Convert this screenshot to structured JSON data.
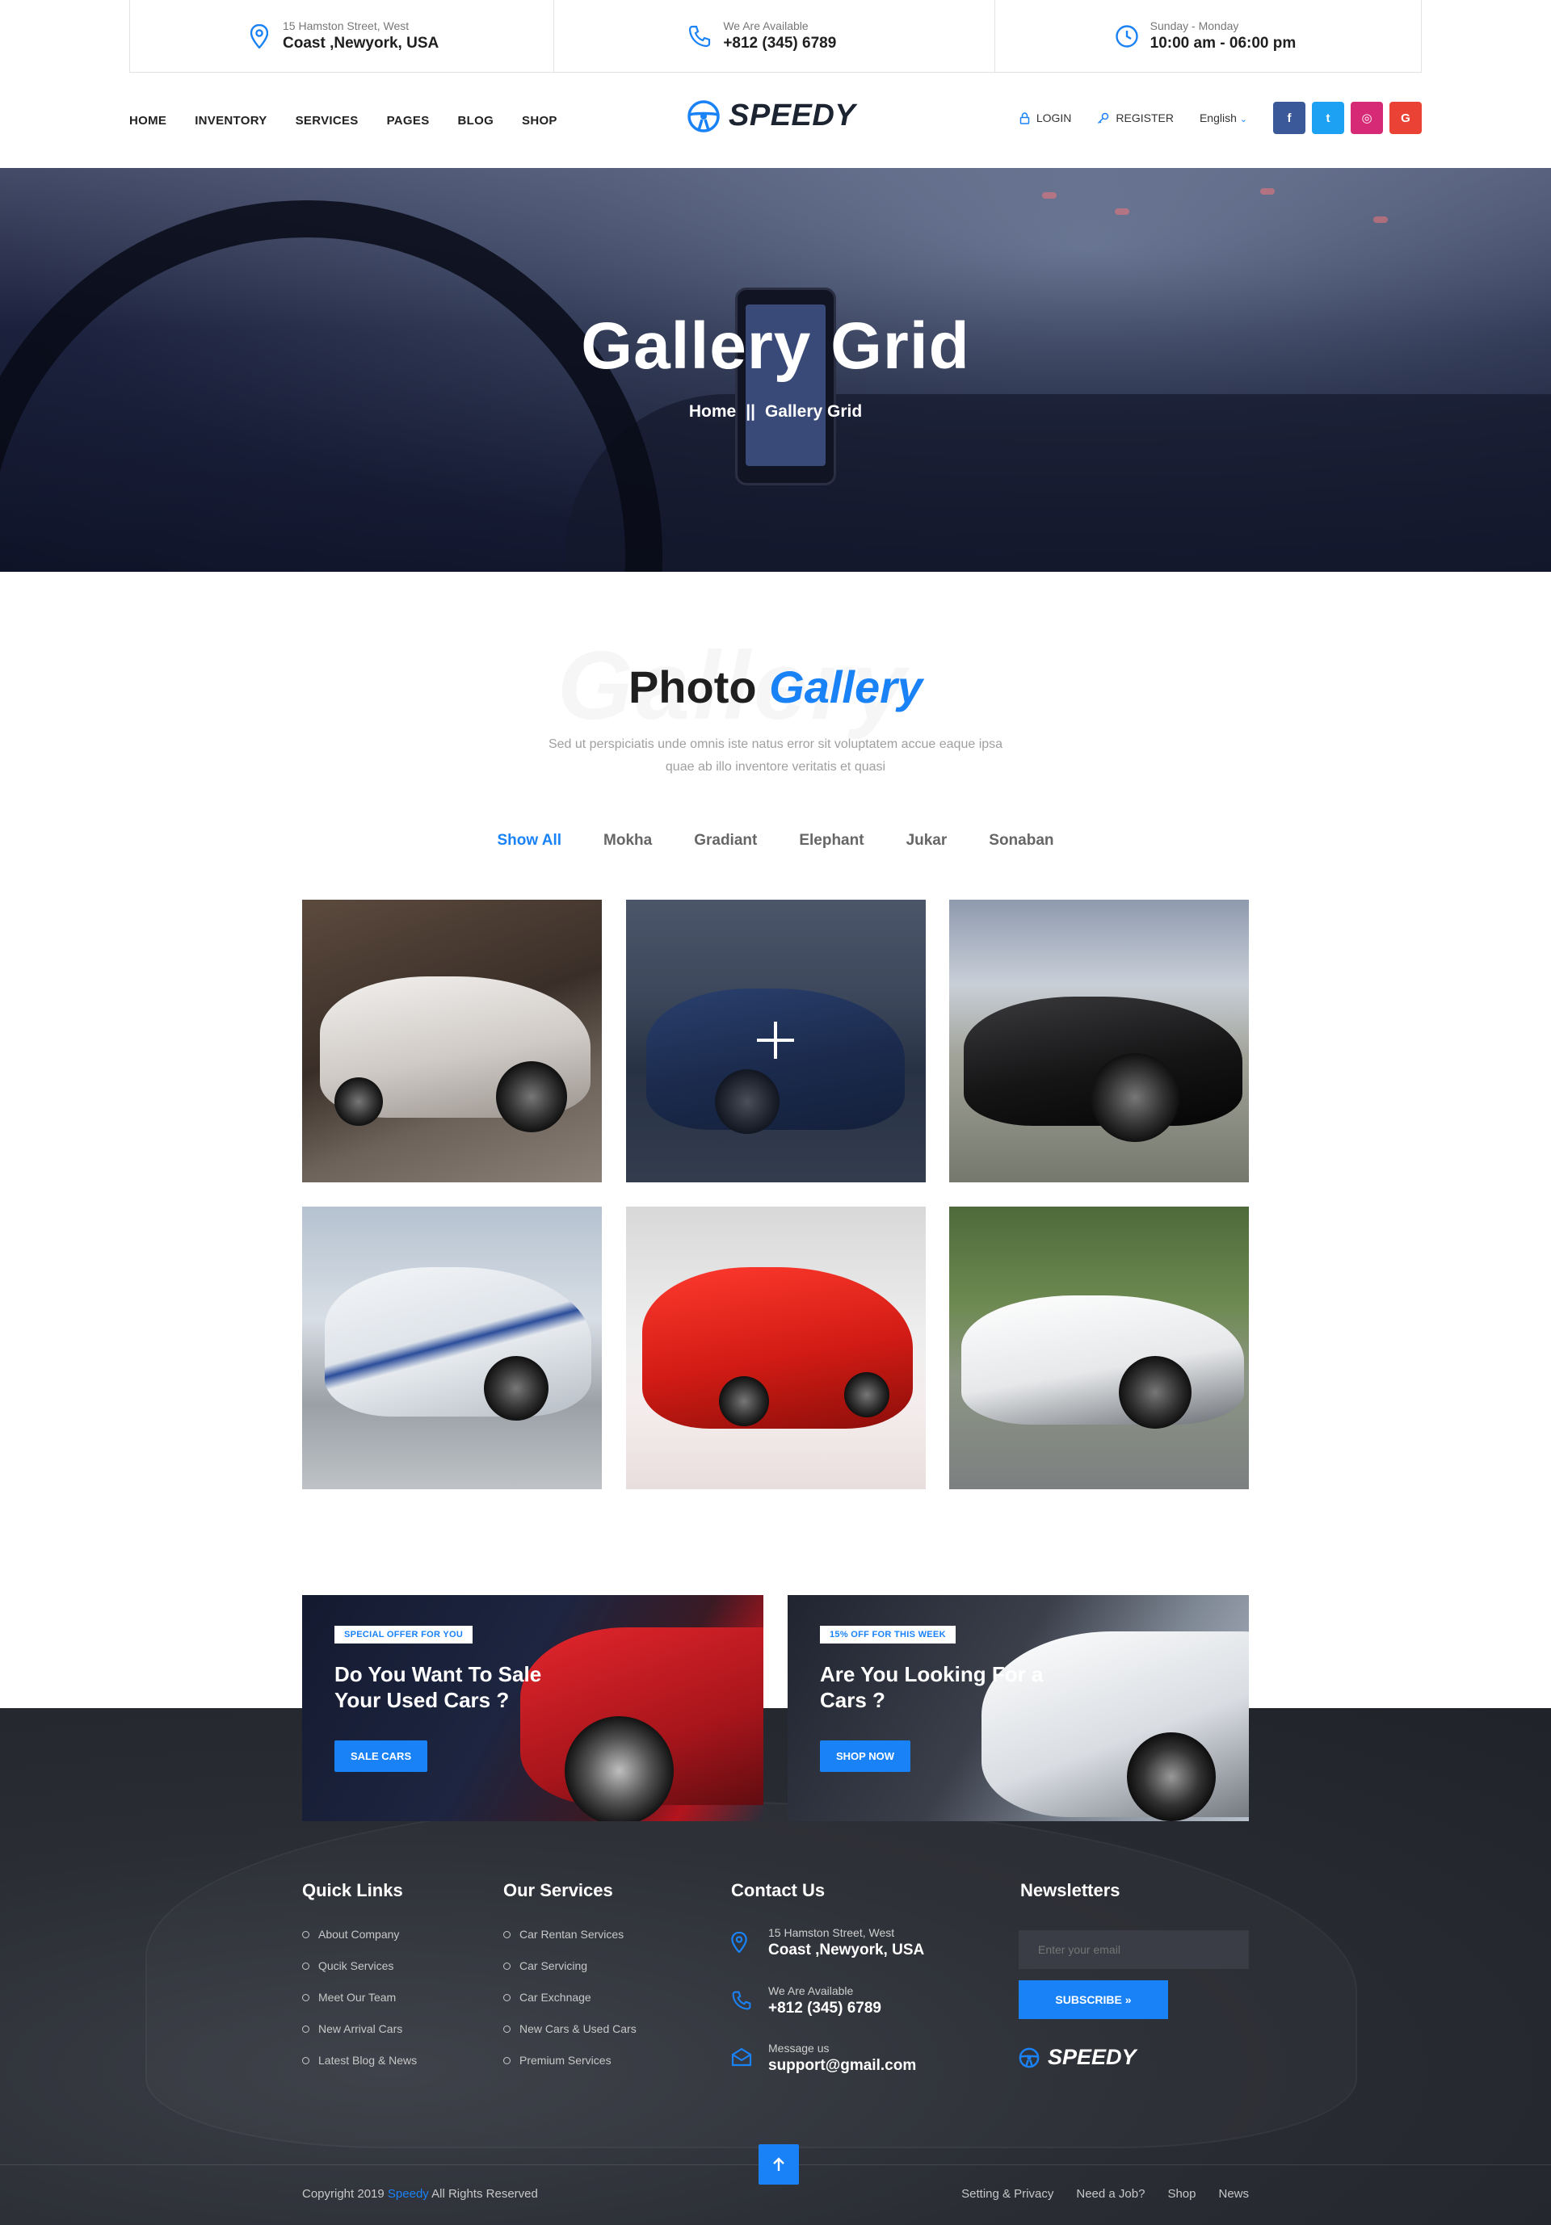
{
  "topbar": {
    "address": {
      "small": "15 Hamston Street, West",
      "big": "Coast ,Newyork, USA"
    },
    "phone": {
      "small": "We Are Available",
      "big": "+812 (345) 6789"
    },
    "hours": {
      "small": "Sunday - Monday",
      "big": "10:00 am - 06:00 pm"
    }
  },
  "nav": {
    "menu": [
      "HOME",
      "INVENTORY",
      "SERVICES",
      "PAGES",
      "BLOG",
      "SHOP"
    ],
    "logo": "SPEEDY",
    "login": "LOGIN",
    "register": "REGISTER",
    "language": "English",
    "social": [
      {
        "name": "facebook",
        "glyph": "f",
        "color": "#3b5998"
      },
      {
        "name": "twitter",
        "glyph": "t",
        "color": "#1da1f2"
      },
      {
        "name": "instagram",
        "glyph": "◎",
        "color": "#d62976"
      },
      {
        "name": "google",
        "glyph": "G",
        "color": "#ea4335"
      }
    ]
  },
  "hero": {
    "title": "Gallery Grid",
    "crumb_home": "Home",
    "crumb_sep": "||",
    "crumb_current": "Gallery Grid"
  },
  "gallery": {
    "title_dark": "Photo",
    "title_accent": "Gallery",
    "subtitle": "Sed ut perspiciatis unde omnis iste natus error sit voluptatem accue eaque ipsa quae ab illo inventore veritatis et quasi",
    "filters": [
      "Show All",
      "Mokha",
      "Gradiant",
      "Elephant",
      "Jukar",
      "Sonaban"
    ],
    "active_filter": "Show All",
    "accent_color": "#1a82f7"
  },
  "promos": [
    {
      "tag": "SPECIAL OFFER FOR YOU",
      "title": "Do You Want To Sale Your Used Cars ?",
      "button": "SALE CARS"
    },
    {
      "tag": "15% OFF FOR THIS WEEK",
      "title": "Are You Looking For a Cars ?",
      "button": "SHOP NOW"
    }
  ],
  "footer": {
    "quick_links": {
      "heading": "Quick Links",
      "items": [
        "About Company",
        "Qucik Services",
        "Meet Our Team",
        "New Arrival Cars",
        "Latest Blog & News"
      ]
    },
    "services": {
      "heading": "Our Services",
      "items": [
        "Car Rentan Services",
        "Car Servicing",
        "Car Exchnage",
        "New Cars & Used Cars",
        "Premium Services"
      ]
    },
    "contact": {
      "heading": "Contact Us",
      "address_small": "15 Hamston Street, West",
      "address_big": "Coast ,Newyork, USA",
      "phone_small": "We Are Available",
      "phone_big": "+812 (345) 6789",
      "mail_small": "Message us",
      "mail_big": "support@gmail.com"
    },
    "newsletter": {
      "heading": "Newsletters",
      "placeholder": "Enter your email",
      "button": "SUBSCRIBE »",
      "logo": "SPEEDY"
    },
    "copyright_pre": "Copyright  2019",
    "copyright_brand": "Speedy",
    "copyright_post": "All Rights Reserved",
    "links": [
      "Setting & Privacy",
      "Need a Job?",
      "Shop",
      "News"
    ]
  }
}
